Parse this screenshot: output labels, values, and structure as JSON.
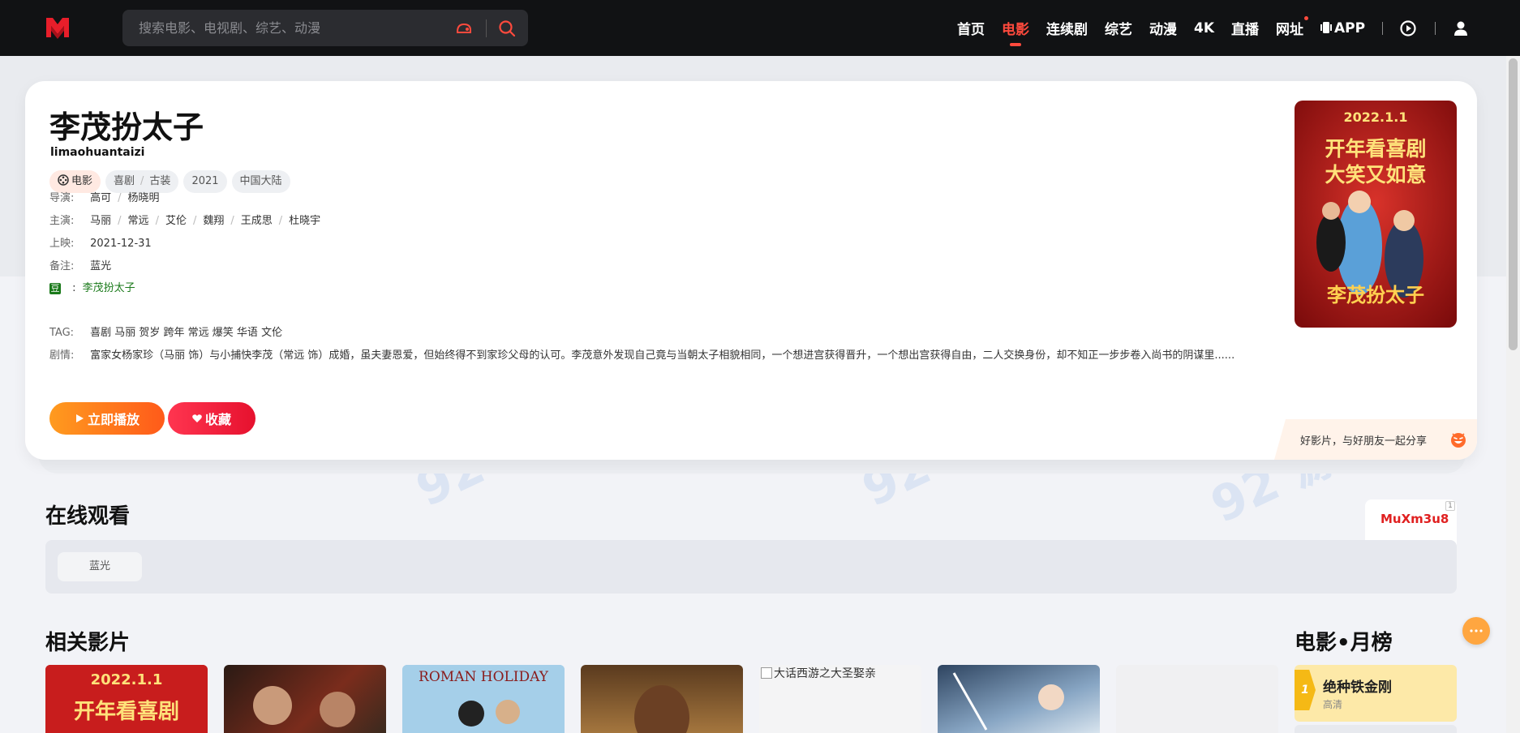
{
  "search": {
    "placeholder": "搜索电影、电视剧、综艺、动漫"
  },
  "nav": {
    "items": [
      "首页",
      "电影",
      "连续剧",
      "综艺",
      "动漫",
      "4K",
      "直播",
      "网址"
    ],
    "app_label": "APP",
    "active_index": 1
  },
  "movie": {
    "title": "李茂扮太子",
    "pinyin": "limaohuantaizi",
    "type_tag": "电影",
    "genre_tags": [
      "喜剧",
      "古装"
    ],
    "year": "2021",
    "region": "中国大陆",
    "directors_label": "导演:",
    "directors": [
      "高可",
      "杨晓明"
    ],
    "actors_label": "主演:",
    "actors": [
      "马丽",
      "常远",
      "艾伦",
      "魏翔",
      "王成思",
      "杜晓宇"
    ],
    "release_label": "上映:",
    "release": "2021-12-31",
    "note_label": "备注:",
    "note": "蓝光",
    "douban_glyph": "豆",
    "douban_colon": ":",
    "douban_title": "李茂扮太子",
    "tag_label": "TAG:",
    "tag_text": "喜剧 马丽 贺岁 跨年 常远 爆笑 华语 文伦",
    "plot_label": "剧情:",
    "plot": "富家女杨家珍（马丽 饰）与小捕快李茂（常远 饰）成婚，虽夫妻恩爱，但始终得不到家珍父母的认可。李茂意外发现自己竟与当朝太子相貌相同，一个想进宫获得晋升，一个想出宫获得自由，二人交换身份，却不知正一步步卷入尚书的阴谋里......",
    "poster_date": "2022.1.1",
    "poster_slogan_1": "开年看喜剧",
    "poster_slogan_2": "大笑又如意",
    "poster_title": "李茂扮太子"
  },
  "buttons": {
    "play": "立即播放",
    "favorite": "收藏"
  },
  "share": {
    "text": "好影片，与好朋友一起分享"
  },
  "watch": {
    "title": "在线观看",
    "source_code": "MuXm3u8",
    "source_num": "1",
    "episodes": [
      "蓝光"
    ]
  },
  "related": {
    "title": "相关影片",
    "items": [
      {
        "caption": "2022.1.1",
        "subcaption": "开年看喜剧"
      },
      {
        "caption": ""
      },
      {
        "caption": "ROMAN HOLIDAY"
      },
      {
        "caption": ""
      },
      {
        "alt": "大话西游之大圣娶亲"
      },
      {
        "caption": ""
      },
      {
        "caption": ""
      }
    ]
  },
  "ranking": {
    "title": "电影•月榜",
    "items": [
      {
        "rank": "1",
        "name": "绝种铁金刚",
        "sub": "高清"
      }
    ]
  },
  "colors": {
    "accent": "#ff4a3d",
    "topbar": "#111214",
    "play": "#ff7a1a",
    "favorite": "#f0213c"
  }
}
